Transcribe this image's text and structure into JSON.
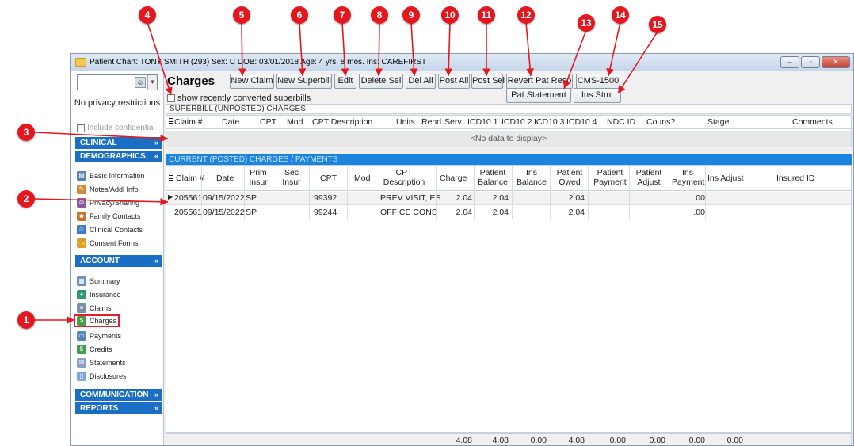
{
  "window": {
    "title": "Patient Chart: TONY SMITH (293)  Sex: U  DOB: 03/01/2018  Age: 4 yrs. 8 mos.  Ins: CAREFIRST",
    "controls": [
      "–",
      "▫",
      "✕"
    ]
  },
  "sidebar": {
    "privacy": "No privacy restrictions",
    "include_confidential": "Include confidential",
    "sections": [
      {
        "label": "CLINICAL",
        "chevron": "»"
      },
      {
        "label": "DEMOGRAPHICS",
        "chevron": "«"
      },
      {
        "label": "ACCOUNT",
        "chevron": "«"
      },
      {
        "label": "COMMUNICATION",
        "chevron": "»"
      },
      {
        "label": "REPORTS",
        "chevron": "»"
      }
    ],
    "demographics_items": [
      "Basic Information",
      "Notes/Addl Info",
      "Privacy/Sharing",
      "Family Contacts",
      "Clinical Contacts",
      "Consent Forms"
    ],
    "account_items": [
      "Summary",
      "Insurance",
      "Claims",
      "Charges",
      "Payments",
      "Credits",
      "Statements",
      "Disclosures"
    ]
  },
  "main": {
    "title": "Charges",
    "buttons": {
      "new_claim": "New Claim",
      "new_superbill": "New Superbill",
      "edit": "Edit",
      "delete_sel": "Delete Sel",
      "del_all": "Del All",
      "post_all": "Post All",
      "post_sel": "Post Sel",
      "revert": "Revert Pat Resp",
      "cms": "CMS-1500",
      "pat_statement": "Pat Statement",
      "ins_stmt": "Ins Stmt"
    },
    "show_converted": "show recently converted superbills",
    "superbill_label": "SUPERBILL (UNPOSTED) CHARGES",
    "superbill_columns": [
      "Claim #",
      "Date",
      "CPT",
      "Mod",
      "CPT Description",
      "Units",
      "Rend",
      "Serv",
      "ICD10 1",
      "ICD10 2",
      "ICD10 3",
      "ICD10 4",
      "NDC ID",
      "Couns?",
      "Stage",
      "Comments"
    ],
    "no_data": "<No data to display>",
    "current_label": "CURRENT (POSTED) CHARGES / PAYMENTS",
    "current_columns": [
      "Claim #",
      "Date",
      "Prim Insur",
      "Sec Insur",
      "CPT",
      "Mod",
      "CPT Description",
      "Charge",
      "Patient Balance",
      "Ins Balance",
      "Patient Owed",
      "Patient Payment",
      "Patient Adjust",
      "Ins Payment",
      "Ins Adjust",
      "Insured ID"
    ],
    "rows": [
      {
        "claim": "205561",
        "date": "09/15/2022",
        "prim": "SP",
        "cpt": "99392",
        "desc": "PREV VISIT, ES",
        "charge": "2.04",
        "pbal": "2.04",
        "owed": "2.04",
        "inspay": ".00"
      },
      {
        "claim": "205561",
        "date": "09/15/2022",
        "prim": "SP",
        "cpt": "99244",
        "desc": "OFFICE CONS",
        "charge": "2.04",
        "pbal": "2.04",
        "owed": "2.04",
        "inspay": ".00"
      }
    ],
    "totals": {
      "charge": "4.08",
      "pbal": "4.08",
      "insbal": "0.00",
      "owed": "4.08",
      "ppay": "0.00",
      "padj": "0.00",
      "inspay": "0.00",
      "insadj": "0.00"
    }
  },
  "callouts": [
    "1",
    "2",
    "3",
    "4",
    "5",
    "6",
    "7",
    "8",
    "9",
    "10",
    "11",
    "12",
    "13",
    "14",
    "15"
  ]
}
